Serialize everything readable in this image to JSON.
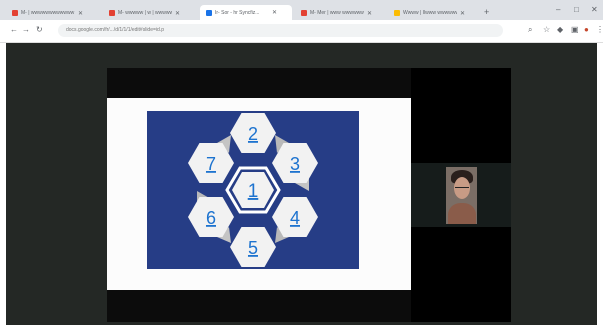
{
  "browser": {
    "tabs": [
      {
        "label": "M- | wwwwwwwwwwww | w | w w w",
        "color": "#e34133"
      },
      {
        "label": "M- wwwww | w | wwwwwwwwww",
        "color": "#e34133"
      },
      {
        "label": "Ir- Sor - hr Syncfiz...",
        "color": "#1a73e8"
      },
      {
        "label": "M- Mer | www wwwwwwwwwww",
        "color": "#e34133"
      },
      {
        "label": "Wwww | Ilwww wwwwwww",
        "color": "#fbbc04"
      }
    ],
    "address": "docs.google.com/fr/.../d/1/1/1/edit#slide=id.p",
    "colors": {
      "chrome": "#dee1e6",
      "stage": "#242825",
      "slide_panel": "#263d86",
      "number": "#1d73cf"
    }
  },
  "slide": {
    "hexagons": [
      {
        "id": "center",
        "label": "1"
      },
      {
        "id": "top",
        "label": "2"
      },
      {
        "id": "upper-right",
        "label": "3"
      },
      {
        "id": "lower-right",
        "label": "4"
      },
      {
        "id": "bottom",
        "label": "5"
      },
      {
        "id": "lower-left",
        "label": "6"
      },
      {
        "id": "upper-left",
        "label": "7"
      }
    ]
  },
  "participant": {
    "icon": "participant-video-icon"
  }
}
